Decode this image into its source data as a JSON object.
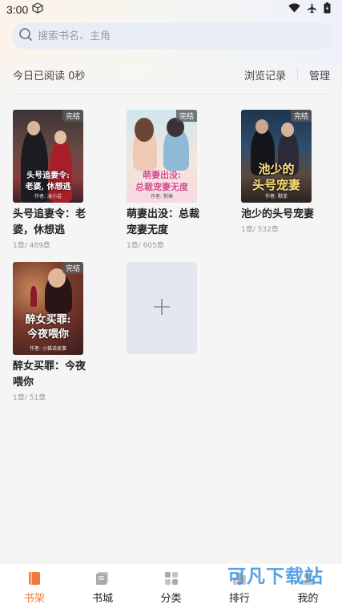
{
  "status_bar": {
    "time": "3:00"
  },
  "search": {
    "placeholder": "搜索书名、主角"
  },
  "reading": {
    "today_text": "今日已阅读 0秒",
    "history_label": "浏览记录",
    "manage_label": "管理"
  },
  "books": [
    {
      "title": "头号追妻令：老婆，休想逃",
      "progress": "1章/ 489章",
      "badge": "完结",
      "cover_title": "头号追妻令:\n老婆, 休想逃",
      "cover_author": "作者: 凌小芸"
    },
    {
      "title": "萌妻出没：总裁宠妻无度",
      "progress": "1章/ 605章",
      "badge": "完结",
      "cover_title": "萌妻出没:\n总裁宠妻无度",
      "cover_author": "作者: 默琳"
    },
    {
      "title": "池少的头号宠妻",
      "progress": "1章/ 532章",
      "badge": "完结",
      "cover_title": "池少的\n头号宠妻",
      "cover_author": "作者: 默菲"
    },
    {
      "title": "醉女买罪：今夜喂你",
      "progress": "1章/ 51章",
      "badge": "完结",
      "cover_title": "醉女买罪:\n今夜喂你",
      "cover_author": "作者: 小猫说故事"
    }
  ],
  "tabs": [
    {
      "label": "书架",
      "icon": "bookshelf-icon",
      "active": true
    },
    {
      "label": "书城",
      "icon": "bookstore-icon",
      "active": false
    },
    {
      "label": "分类",
      "icon": "category-icon",
      "active": false
    },
    {
      "label": "排行",
      "icon": "ranking-icon",
      "active": false
    },
    {
      "label": "我的",
      "icon": "profile-icon",
      "active": false
    }
  ],
  "watermark": "可凡下载站",
  "colors": {
    "accent": "#f0793a",
    "search_bg": "#e9edf6",
    "add_card_bg": "#e4e7f0"
  }
}
